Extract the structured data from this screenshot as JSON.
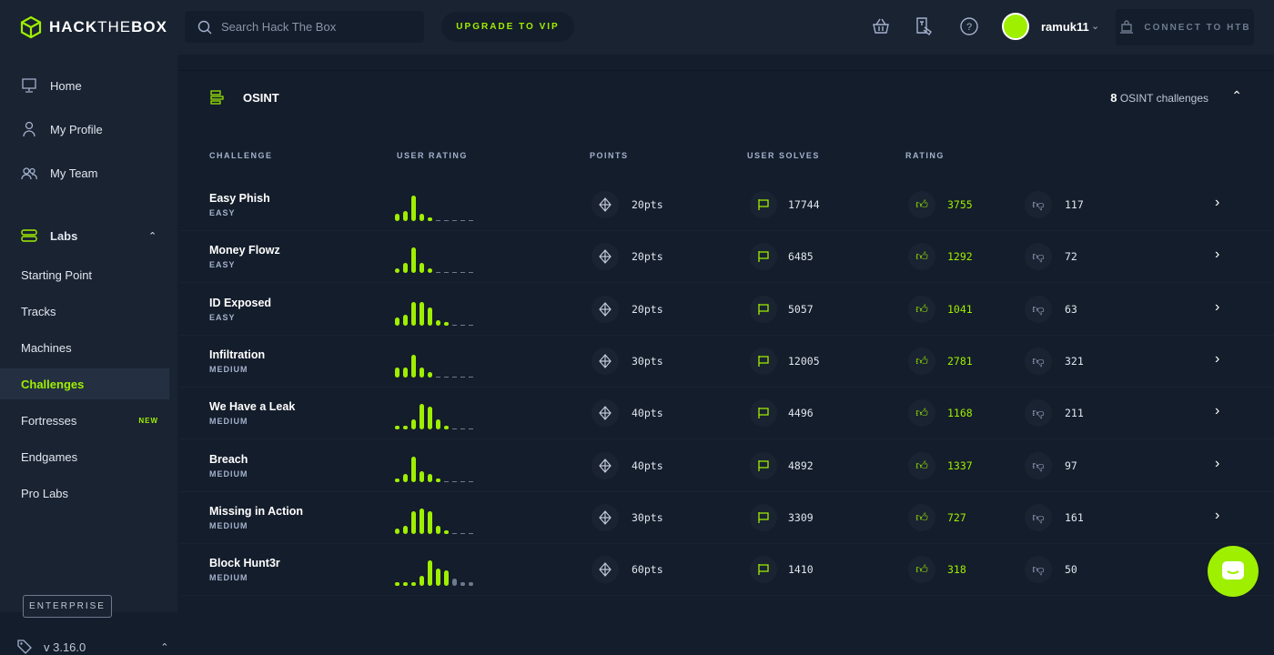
{
  "header": {
    "logo_bold": "HACK",
    "logo_thin": "THE",
    "logo_bold2": "BOX",
    "search_placeholder": "Search Hack The Box",
    "vip_label": "UPGRADE TO VIP",
    "username": "ramuk11",
    "connect_label": "CONNECT TO HTB"
  },
  "sidebar": {
    "home": "Home",
    "profile": "My Profile",
    "team": "My Team",
    "labs": "Labs",
    "sub": [
      "Starting Point",
      "Tracks",
      "Machines",
      "Challenges",
      "Fortresses",
      "Endgames",
      "Pro Labs"
    ],
    "new_badge": "NEW",
    "enterprise": "ENTERPRISE",
    "version": "v 3.16.0"
  },
  "section": {
    "title": "OSINT",
    "count": "8",
    "count_label": "OSINT challenges"
  },
  "columns": [
    "CHALLENGE",
    "USER RATING",
    "POINTS",
    "USER SOLVES",
    "RATING"
  ],
  "challenges": [
    {
      "name": "Easy Phish",
      "difficulty": "EASY",
      "rating_dist": [
        3,
        4,
        10,
        3,
        1,
        0,
        0,
        0,
        0,
        0
      ],
      "points": "20pts",
      "solves": "17744",
      "likes": "3755",
      "dislikes": "117"
    },
    {
      "name": "Money Flowz",
      "difficulty": "EASY",
      "rating_dist": [
        2,
        4,
        10,
        4,
        2,
        0,
        0,
        0,
        0,
        0
      ],
      "points": "20pts",
      "solves": "6485",
      "likes": "1292",
      "dislikes": "72"
    },
    {
      "name": "ID Exposed",
      "difficulty": "EASY",
      "rating_dist": [
        3,
        4,
        9,
        9,
        7,
        2,
        1,
        0,
        0,
        0
      ],
      "points": "20pts",
      "solves": "5057",
      "likes": "1041",
      "dislikes": "63"
    },
    {
      "name": "Infiltration",
      "difficulty": "MEDIUM",
      "rating_dist": [
        4,
        4,
        9,
        4,
        2,
        0,
        0,
        0,
        0,
        0
      ],
      "points": "30pts",
      "solves": "12005",
      "likes": "2781",
      "dislikes": "321"
    },
    {
      "name": "We Have a Leak",
      "difficulty": "MEDIUM",
      "rating_dist": [
        1,
        1,
        4,
        10,
        9,
        4,
        1,
        0,
        0,
        0
      ],
      "points": "40pts",
      "solves": "4496",
      "likes": "1168",
      "dislikes": "211"
    },
    {
      "name": "Breach",
      "difficulty": "MEDIUM",
      "rating_dist": [
        1,
        3,
        10,
        4,
        3,
        1,
        0,
        0,
        0,
        0
      ],
      "points": "40pts",
      "solves": "4892",
      "likes": "1337",
      "dislikes": "97"
    },
    {
      "name": "Missing in Action",
      "difficulty": "MEDIUM",
      "rating_dist": [
        2,
        3,
        9,
        10,
        9,
        3,
        1,
        0,
        0,
        0
      ],
      "points": "30pts",
      "solves": "3309",
      "likes": "727",
      "dislikes": "161"
    },
    {
      "name": "Block Hunt3r",
      "difficulty": "MEDIUM",
      "rating_dist": [
        1,
        0.5,
        1,
        4,
        10,
        7,
        6,
        3,
        1,
        1
      ],
      "points": "60pts",
      "solves": "1410",
      "likes": "318",
      "dislikes": "50"
    }
  ],
  "colors": {
    "accent": "#9fef00",
    "bg": "#141d2b",
    "panel": "#1a2332"
  }
}
